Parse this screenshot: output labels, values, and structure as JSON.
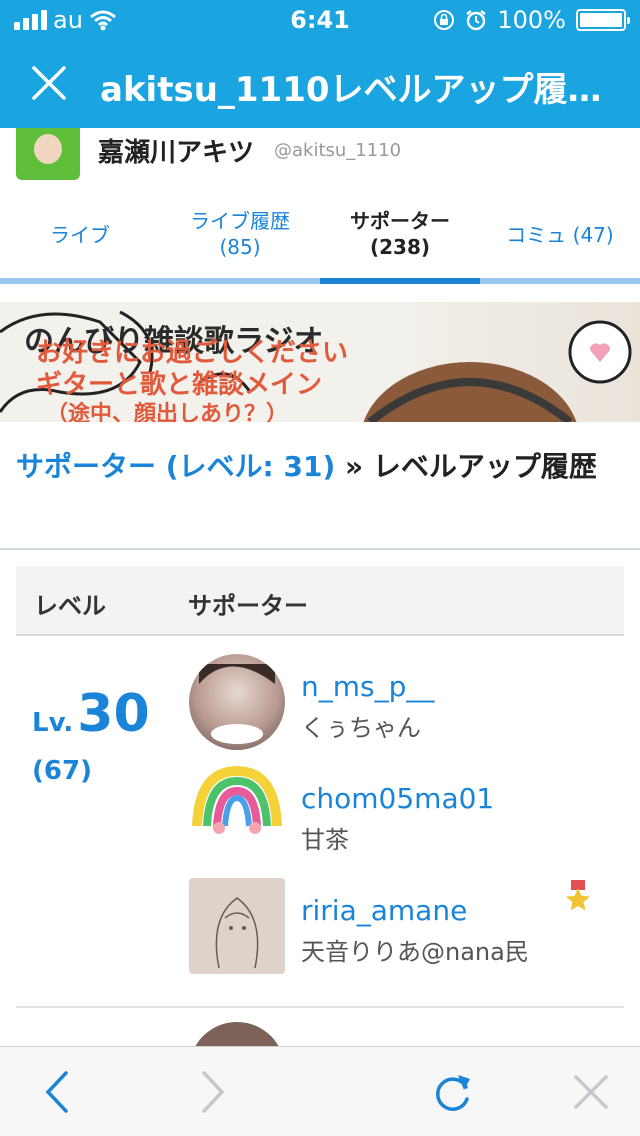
{
  "status_bar": {
    "carrier": "au",
    "time": "6:41",
    "battery": "100%"
  },
  "nav": {
    "title": "akitsu_1110レベルアップ履…"
  },
  "profile": {
    "name": "嘉瀬川アキツ",
    "handle": "@akitsu_1110"
  },
  "tabs": [
    {
      "label": "ライブ",
      "count": ""
    },
    {
      "label": "ライブ履歴",
      "count": "(85)"
    },
    {
      "label": "サポーター",
      "count": "(238)"
    },
    {
      "label": "コミュ (47)",
      "count": ""
    }
  ],
  "banner": {
    "line1": "のんびり雑談歌ラジオ",
    "line2": "お好きにお過ごしください",
    "line3": "ギターと歌と雑談メイン",
    "line4": "（途中、顔出しあり？）"
  },
  "heading": {
    "link": "サポーター (レベル: 31)",
    "separator": " » ",
    "rest": "レベルアップ履歴"
  },
  "table": {
    "col_level": "レベル",
    "col_supporter": "サポーター"
  },
  "level_group": {
    "lv_prefix": "Lv.",
    "level": "30",
    "count": "(67)",
    "supporters": [
      {
        "id": "n_ms_p__",
        "nick": "くぅちゃん"
      },
      {
        "id": "chom05ma01",
        "nick": "甘茶"
      },
      {
        "id": "riria_amane",
        "nick": "天音りりあ@nana民"
      }
    ]
  },
  "icons": {
    "close": "close-icon",
    "back": "chevron-left-icon",
    "forward": "chevron-right-icon",
    "reload": "reload-icon",
    "stop": "x-icon",
    "medal": "medal-icon"
  },
  "colors": {
    "header": "#1aa4e0",
    "link": "#1a84d8",
    "banner_text": "#e25a3c"
  }
}
